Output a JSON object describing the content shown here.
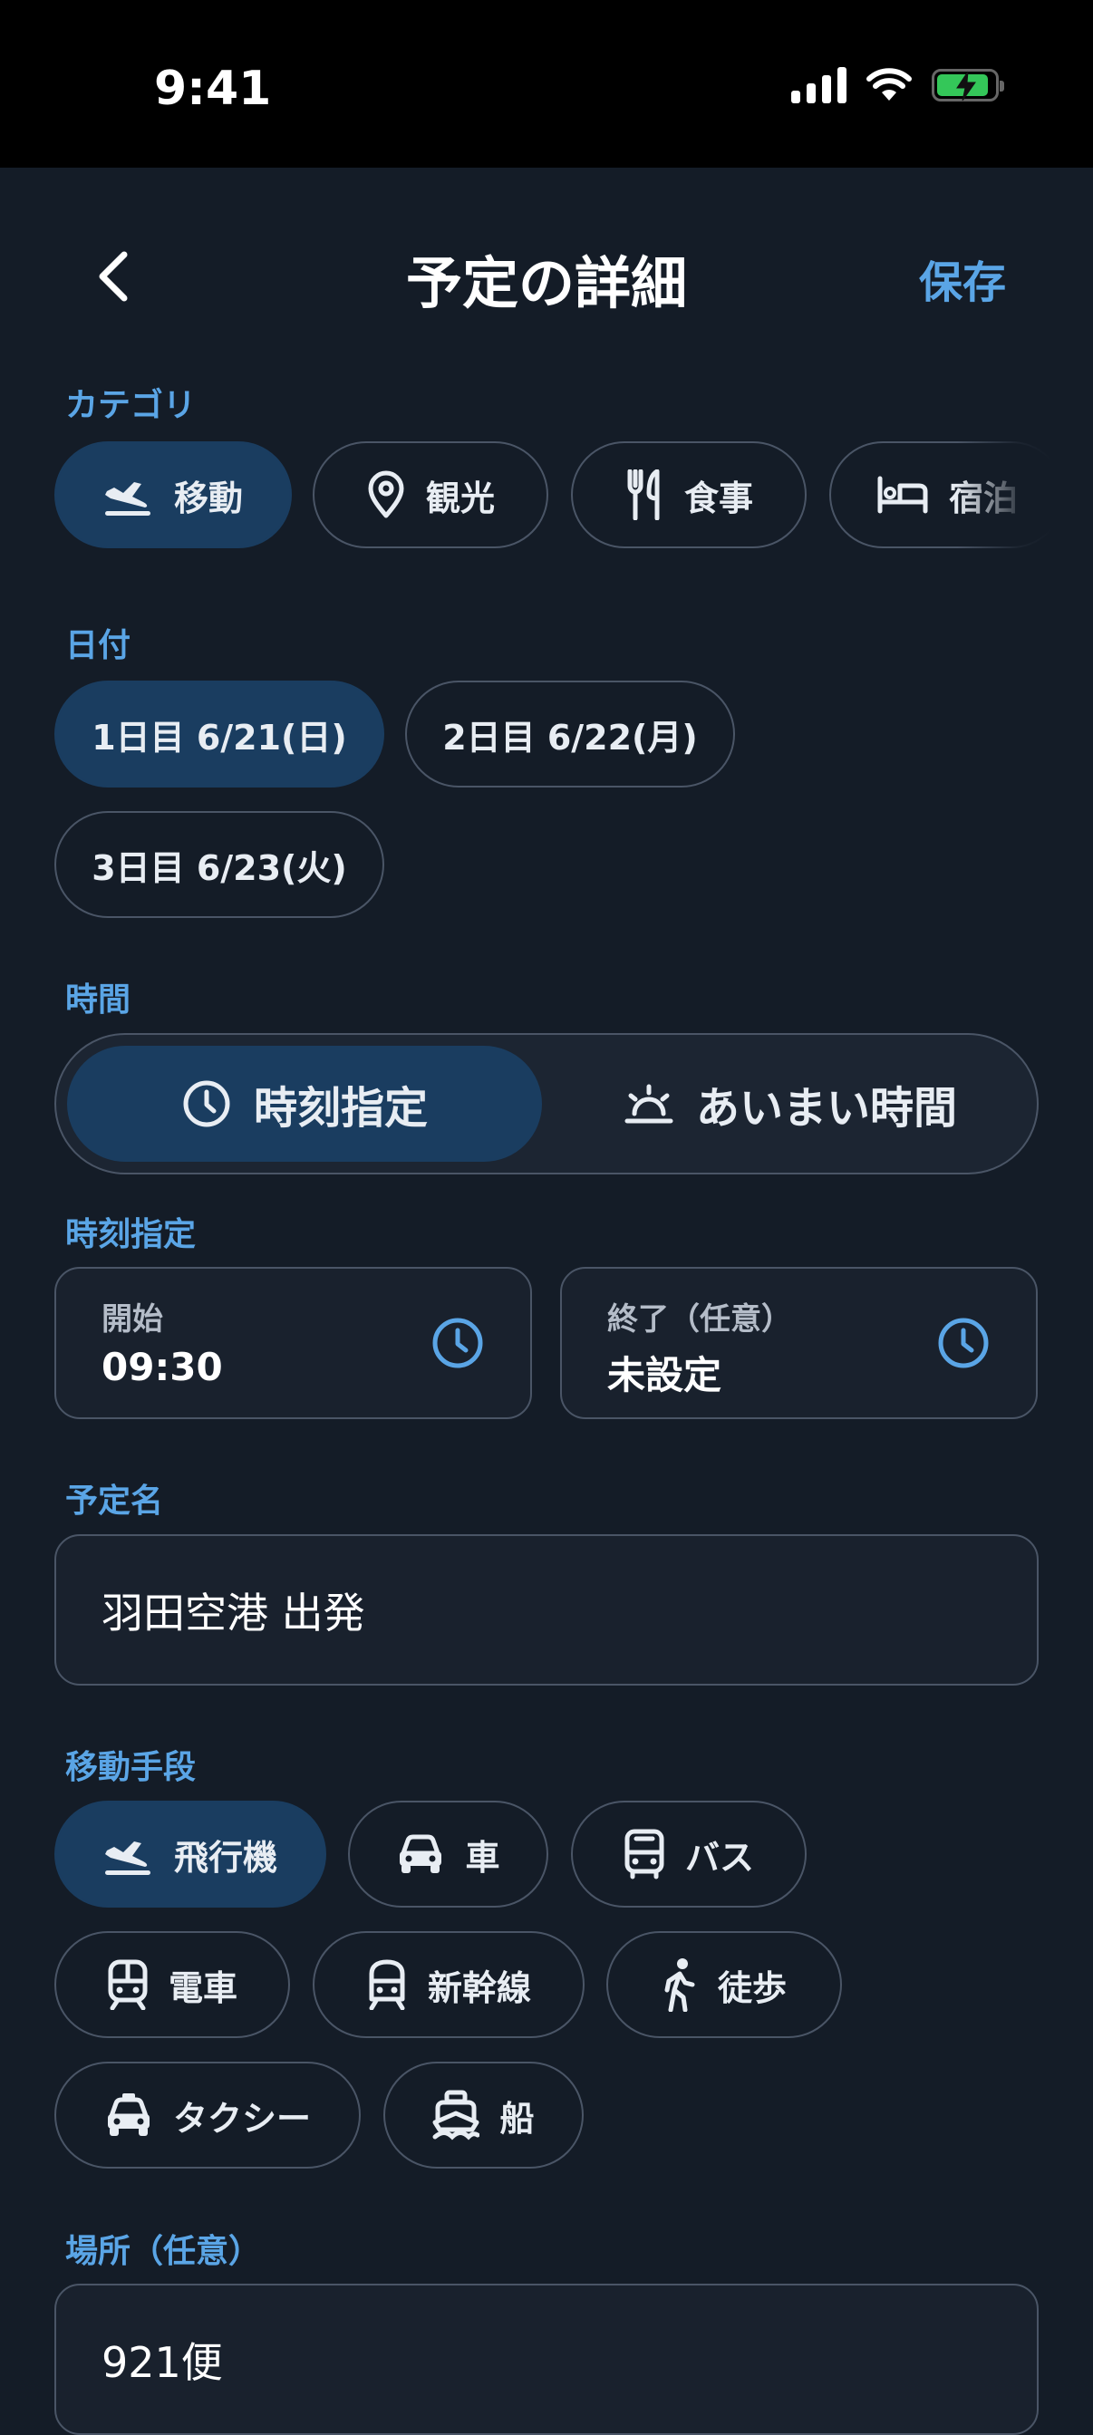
{
  "status_bar": {
    "time": "9:41"
  },
  "header": {
    "title": "予定の詳細",
    "save_label": "保存"
  },
  "category": {
    "label": "カテゴリ",
    "items": [
      {
        "label": "移動",
        "icon": "airplane-icon",
        "selected": true
      },
      {
        "label": "観光",
        "icon": "map-pin-icon",
        "selected": false
      },
      {
        "label": "食事",
        "icon": "utensils-icon",
        "selected": false
      },
      {
        "label": "宿泊",
        "icon": "bed-icon",
        "selected": false
      }
    ]
  },
  "date": {
    "label": "日付",
    "items": [
      {
        "label": "1日目 6/21(日)",
        "selected": true
      },
      {
        "label": "2日目 6/22(月)",
        "selected": false
      },
      {
        "label": "3日目 6/23(火)",
        "selected": false
      }
    ]
  },
  "time": {
    "label": "時間",
    "options": [
      {
        "label": "時刻指定",
        "icon": "clock-icon",
        "selected": true
      },
      {
        "label": "あいまい時間",
        "icon": "sunrise-icon",
        "selected": false
      }
    ]
  },
  "time_spec": {
    "label": "時刻指定",
    "start": {
      "label": "開始",
      "value": "09:30"
    },
    "end": {
      "label": "終了（任意）",
      "value": "未設定"
    }
  },
  "event_name": {
    "label": "予定名",
    "value": "羽田空港 出発"
  },
  "transport": {
    "label": "移動手段",
    "items": [
      {
        "label": "飛行機",
        "icon": "airplane-icon",
        "selected": true
      },
      {
        "label": "車",
        "icon": "car-icon",
        "selected": false
      },
      {
        "label": "バス",
        "icon": "bus-icon",
        "selected": false
      },
      {
        "label": "電車",
        "icon": "train-icon",
        "selected": false
      },
      {
        "label": "新幹線",
        "icon": "bullet-train-icon",
        "selected": false
      },
      {
        "label": "徒歩",
        "icon": "walking-icon",
        "selected": false
      },
      {
        "label": "タクシー",
        "icon": "taxi-icon",
        "selected": false
      },
      {
        "label": "船",
        "icon": "ship-icon",
        "selected": false
      }
    ]
  },
  "location": {
    "label": "場所（任意）",
    "value": "921便"
  },
  "colors": {
    "background": "#141c27",
    "accent": "#5aa5e6",
    "selected": "#1a3d60",
    "border": "#4a5566"
  }
}
